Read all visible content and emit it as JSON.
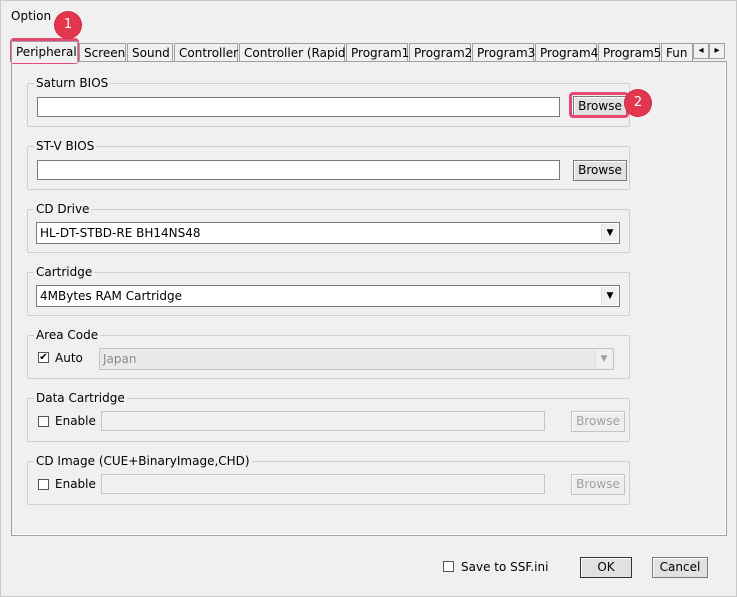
{
  "window": {
    "title": "Option"
  },
  "tabs": [
    {
      "label": "Peripheral"
    },
    {
      "label": "Screen"
    },
    {
      "label": "Sound"
    },
    {
      "label": "Controller"
    },
    {
      "label": "Controller (Rapid)"
    },
    {
      "label": "Program1"
    },
    {
      "label": "Program2"
    },
    {
      "label": "Program3"
    },
    {
      "label": "Program4"
    },
    {
      "label": "Program5"
    },
    {
      "label": "Fun"
    }
  ],
  "tab_scroll": {
    "left_icon": "◂",
    "right_icon": "▸"
  },
  "saturn_bios": {
    "label": "Saturn BIOS",
    "value": "",
    "browse": "Browse"
  },
  "stv_bios": {
    "label": "ST-V BIOS",
    "value": "",
    "browse": "Browse"
  },
  "cd_drive": {
    "label": "CD Drive",
    "selected": "HL-DT-STBD-RE  BH14NS48"
  },
  "cartridge": {
    "label": "Cartridge",
    "selected": "4MBytes RAM Cartridge"
  },
  "area_code": {
    "label": "Area Code",
    "auto_label": "Auto",
    "auto_checked": true,
    "selected": "Japan"
  },
  "data_cartridge": {
    "label": "Data Cartridge",
    "enable_label": "Enable",
    "enable_checked": false,
    "value": "",
    "browse": "Browse"
  },
  "cd_image": {
    "label": "CD Image (CUE+BinaryImage,CHD)",
    "enable_label": "Enable",
    "enable_checked": false,
    "value": "",
    "browse": "Browse"
  },
  "footer": {
    "save_label": "Save to SSF.ini",
    "save_checked": false,
    "ok": "OK",
    "cancel": "Cancel"
  },
  "annotations": {
    "badge1": "1",
    "badge2": "2",
    "color": "#e2374f"
  },
  "icons": {
    "check": "✔",
    "dropdown_arrow": "▼"
  }
}
